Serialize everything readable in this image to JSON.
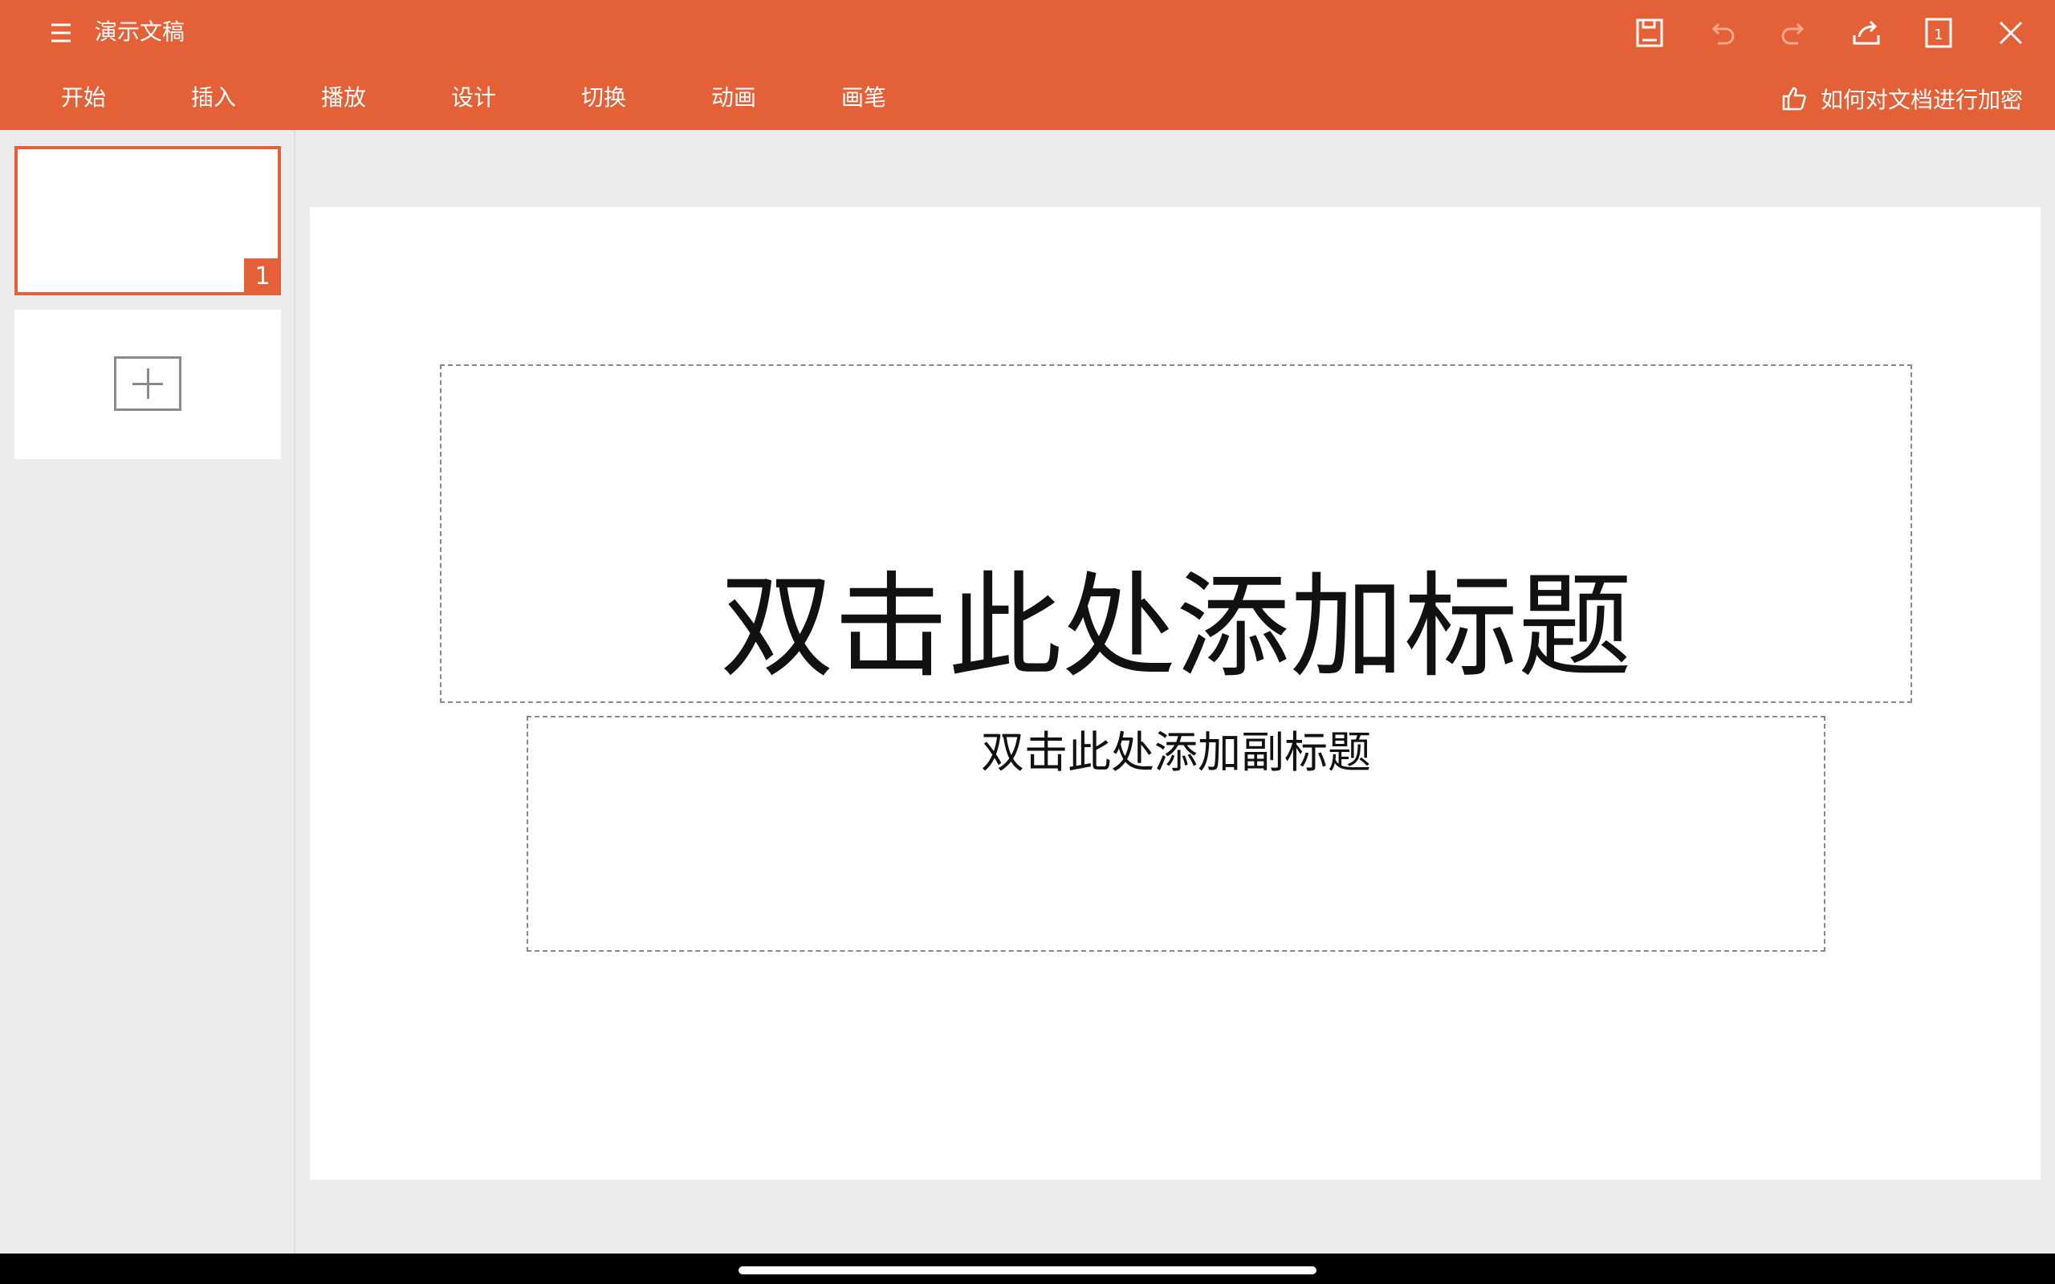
{
  "app": {
    "title": "演示文稿",
    "accent_color": "#e46036"
  },
  "toolbar": {
    "icons": [
      "menu-icon",
      "save-icon",
      "undo-icon",
      "redo-icon",
      "share-icon",
      "page-view-icon",
      "close-icon"
    ],
    "page_view_number": "1"
  },
  "tabs": [
    {
      "label": "开始"
    },
    {
      "label": "插入"
    },
    {
      "label": "播放"
    },
    {
      "label": "设计"
    },
    {
      "label": "切换"
    },
    {
      "label": "动画"
    },
    {
      "label": "画笔"
    }
  ],
  "tip": {
    "icon": "thumbs-up-icon",
    "label": "如何对文档进行加密"
  },
  "slides_panel": {
    "slides": [
      {
        "number": "1",
        "selected": true
      }
    ],
    "add_slide_icon": "plus-icon"
  },
  "slide": {
    "title_placeholder": "双击此处添加标题",
    "subtitle_placeholder": "双击此处添加副标题"
  }
}
